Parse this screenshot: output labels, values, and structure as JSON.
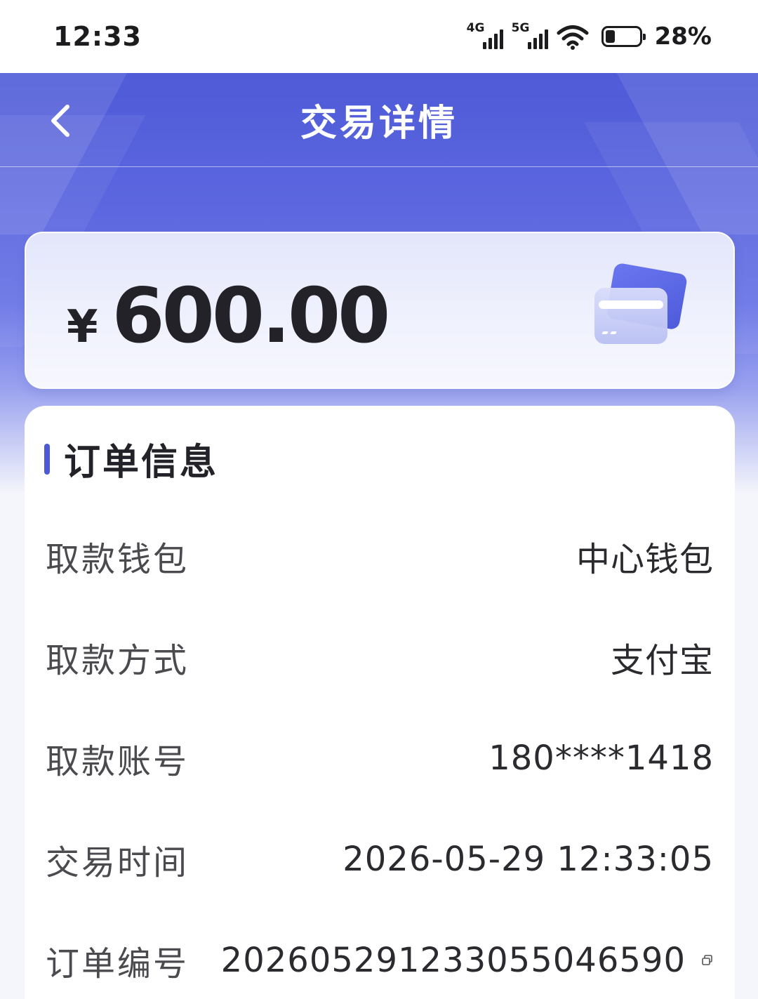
{
  "status_bar": {
    "time": "12:33",
    "network_1": "4G",
    "network_2": "5G",
    "battery_text": "28%",
    "battery_level": 0.28
  },
  "nav": {
    "title": "交易详情",
    "back_icon": "chevron-left-icon"
  },
  "amount": {
    "currency": "¥",
    "value": "600.00",
    "icon": "card-icon"
  },
  "order_info": {
    "title": "订单信息",
    "rows": [
      {
        "label": "取款钱包",
        "value": "中心钱包"
      },
      {
        "label": "取款方式",
        "value": "支付宝"
      },
      {
        "label": "取款账号",
        "value": "180****1418"
      },
      {
        "label": "交易时间",
        "value": "2026-05-29 12:33:05"
      },
      {
        "label": "订单编号",
        "value": "20260529123305504659​0",
        "copy_icon": "copy-icon"
      }
    ]
  },
  "colors": {
    "accent": "#4c5ad6",
    "header": "#5560dc",
    "text_primary": "#222228",
    "text_label": "#4a4a4f"
  }
}
